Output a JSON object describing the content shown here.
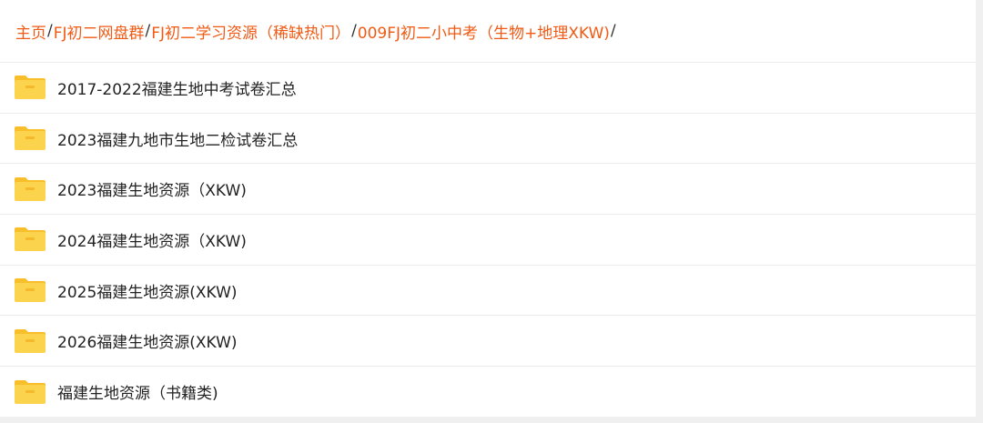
{
  "breadcrumb": {
    "items": [
      {
        "label": "主页"
      },
      {
        "label": "FJ初二网盘群"
      },
      {
        "label": "FJ初二学习资源（稀缺热门）"
      },
      {
        "label": "009FJ初二小中考（生物+地理XKW)"
      }
    ],
    "separator": "/"
  },
  "folder_icon_name": "folder-icon",
  "folders": [
    {
      "name": "2017-2022福建生地中考试卷汇总"
    },
    {
      "name": "2023福建九地市生地二检试卷汇总"
    },
    {
      "name": "2023福建生地资源（XKW)"
    },
    {
      "name": "2024福建生地资源（XKW)"
    },
    {
      "name": "2025福建生地资源(XKW)"
    },
    {
      "name": "2026福建生地资源(XKW)"
    },
    {
      "name": "福建生地资源（书籍类)"
    }
  ],
  "colors": {
    "breadcrumb_link": "#f05a14",
    "folder_body": "#fcd34d",
    "folder_tab": "#f8bf2a"
  }
}
